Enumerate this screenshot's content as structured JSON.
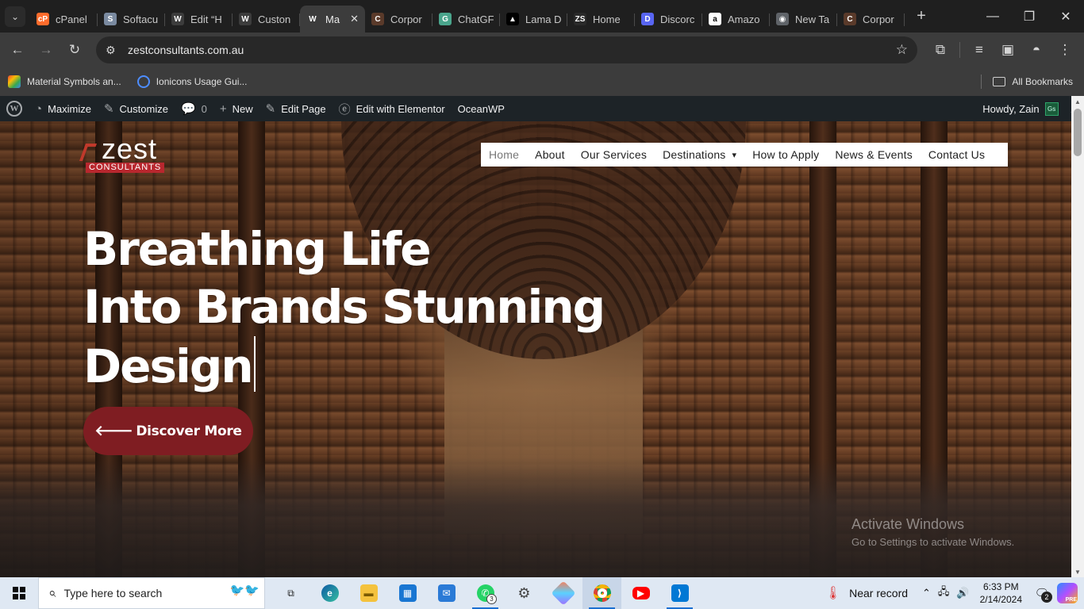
{
  "browser": {
    "tabs": [
      {
        "label": "cPanel",
        "icon": "cpanel-icon",
        "color": "#ff6c2c",
        "glyph": "cP"
      },
      {
        "label": "Softacu",
        "icon": "softaculous-icon",
        "color": "#7a8aa0",
        "glyph": "S"
      },
      {
        "label": "Edit “H",
        "icon": "wordpress-icon",
        "color": "#3c3c3c",
        "glyph": "W"
      },
      {
        "label": "Custon",
        "icon": "wordpress-icon",
        "color": "#3c3c3c",
        "glyph": "W"
      },
      {
        "label": "Ma",
        "icon": "wordpress-icon",
        "color": "#3c3c3c",
        "glyph": "W",
        "active": true
      },
      {
        "label": "Corpor",
        "icon": "theme-icon",
        "color": "#5a3a2a",
        "glyph": "C"
      },
      {
        "label": "ChatGF",
        "icon": "chatgpt-icon",
        "color": "#4aa58c",
        "glyph": "G"
      },
      {
        "label": "Lama D",
        "icon": "lama-icon",
        "color": "#000000",
        "glyph": "▲"
      },
      {
        "label": "Home",
        "icon": "zest-icon",
        "color": "#2a2a2a",
        "glyph": "ZS"
      },
      {
        "label": "Discorc",
        "icon": "discord-icon",
        "color": "#5865f2",
        "glyph": "D"
      },
      {
        "label": "Amazo",
        "icon": "amazon-icon",
        "color": "#ffffff",
        "glyph": "a"
      },
      {
        "label": "New Ta",
        "icon": "chrome-icon",
        "color": "#5f6368",
        "glyph": "◉"
      },
      {
        "label": "Corpor",
        "icon": "theme-icon",
        "color": "#5a3a2a",
        "glyph": "C"
      }
    ],
    "url": "zestconsultants.com.au",
    "bookmarks": [
      {
        "label": "Material Symbols an...",
        "icon": "material-symbols-icon"
      },
      {
        "label": "Ionicons Usage Gui...",
        "icon": "ionicons-icon"
      }
    ],
    "all_bookmarks": "All Bookmarks"
  },
  "wp_admin": {
    "maximize": "Maximize",
    "customize": "Customize",
    "comments_count": "0",
    "new": "New",
    "edit_page": "Edit Page",
    "edit_elementor": "Edit with Elementor",
    "theme": "OceanWP",
    "howdy": "Howdy, Zain",
    "avatar_initials": "Gs"
  },
  "site": {
    "logo_word": "zest",
    "logo_sub": "CONSULTANTS",
    "nav": [
      "Home",
      "About",
      "Our Services",
      "Destinations",
      "How to Apply",
      "News & Events",
      "Contact Us"
    ],
    "headline": [
      "Breathing Life",
      "Into Brands Stunning",
      "Design"
    ],
    "cta": "Discover More"
  },
  "watermark": {
    "line1": "Activate Windows",
    "line2": "Go to Settings to activate Windows."
  },
  "taskbar": {
    "search_placeholder": "Type here to search",
    "whatsapp_badge": "3",
    "weather": "Near record",
    "time": "6:33 PM",
    "date": "2/14/2024",
    "notifications": "2"
  }
}
